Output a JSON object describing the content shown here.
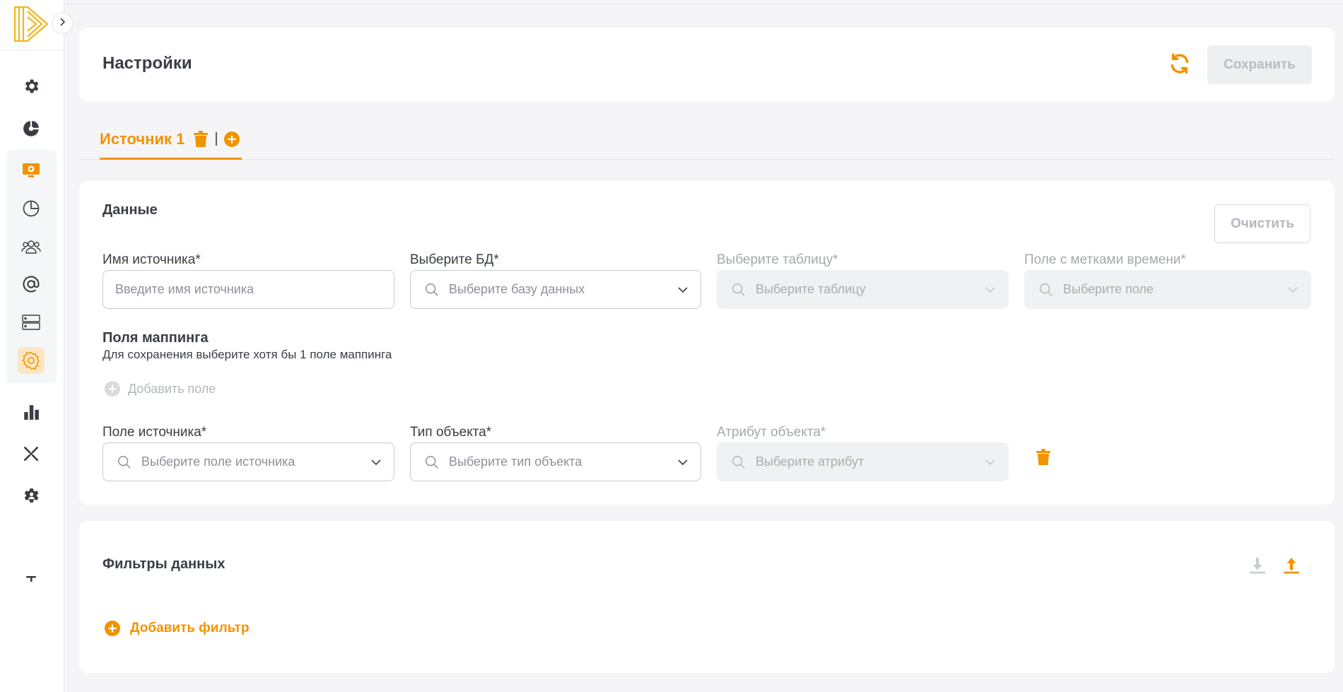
{
  "colors": {
    "accent": "#f29300",
    "sidebar_icon": "#3a3e44",
    "disabled_text": "#b3b7bd"
  },
  "header": {
    "title": "Настройки",
    "refresh_icon": "refresh-icon",
    "save_label": "Сохранить"
  },
  "tabs": {
    "items": [
      {
        "label": "Источник 1"
      }
    ],
    "separator": "|"
  },
  "data_section": {
    "title": "Данные",
    "clear_label": "Очистить",
    "fields": {
      "source_name": {
        "label": "Имя источника*",
        "placeholder": "Введите имя источника"
      },
      "db": {
        "label": "Выберите БД*",
        "placeholder": "Выберите базу данных"
      },
      "table": {
        "label": "Выберите таблицу*",
        "placeholder": "Выберите таблицу"
      },
      "timestamp": {
        "label": "Поле с метками времени*",
        "placeholder": "Выберите поле"
      }
    },
    "mapping": {
      "title": "Поля маппинга",
      "hint": "Для сохранения выберите хотя бы 1 поле маппинга",
      "add_field_label": "Добавить поле",
      "row": {
        "source_field": {
          "label": "Поле источника*",
          "placeholder": "Выберите поле источника"
        },
        "object_type": {
          "label": "Тип объекта*",
          "placeholder": "Выберите тип объекта"
        },
        "object_attr": {
          "label": "Атрибут объекта*",
          "placeholder": "Выберите атрибут"
        }
      }
    }
  },
  "filters": {
    "title": "Фильтры данных",
    "add_filter_label": "Добавить фильтр"
  },
  "sidebar": {
    "items": [
      {
        "icon": "gear-icon"
      },
      {
        "icon": "pie-chart-icon"
      },
      {
        "icon": "monitor-settings-icon"
      },
      {
        "icon": "pie-outline-icon"
      },
      {
        "icon": "users-icon"
      },
      {
        "icon": "at-icon"
      },
      {
        "icon": "server-icon"
      },
      {
        "icon": "settings-flower-icon",
        "active": true
      },
      {
        "icon": "bar-chart-icon"
      },
      {
        "icon": "cross-tools-icon"
      },
      {
        "icon": "users-gear-icon"
      },
      {
        "icon": "text-cursor-icon"
      }
    ]
  }
}
